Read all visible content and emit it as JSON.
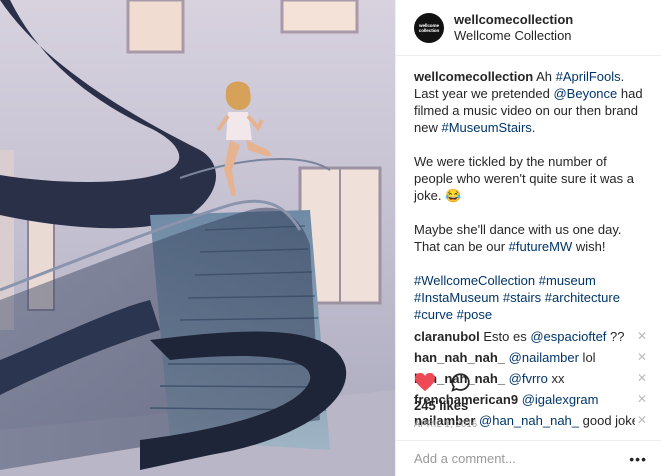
{
  "post": {
    "username": "wellcomecollection",
    "location": "Wellcome Collection",
    "avatar_text": "wellcome collection",
    "photo_alt": "Spiral staircase"
  },
  "caption": {
    "username": "wellcomecollection",
    "p1": [
      {
        "t": "Ah ",
        "k": "text"
      },
      {
        "t": "#AprilFools",
        "k": "tag"
      },
      {
        "t": ". Last year we pretended ",
        "k": "text"
      },
      {
        "t": "@Beyonce",
        "k": "tag"
      },
      {
        "t": " had filmed a music video on our then brand new ",
        "k": "text"
      },
      {
        "t": "#MuseumStairs",
        "k": "tag"
      },
      {
        "t": ".",
        "k": "text"
      }
    ],
    "p2": "We were tickled by the number of people who weren't quite sure it was a joke. 😂",
    "p3_text": "Maybe she'll dance with us one day. That can be our ",
    "p3_tag": "#futureMW",
    "p3_end": " wish!",
    "hashtags": "#WellcomeCollection #museum #InstaMuseum #stairs #architecture #curve #pose"
  },
  "comments": [
    {
      "user": "claranubol",
      "pre": "Esto es ",
      "mention": "@espacioftef",
      "post": " ??"
    },
    {
      "user": "han_nah_nah_",
      "pre": "",
      "mention": "@nailamber",
      "post": " lol"
    },
    {
      "user": "han_nah_nah_",
      "pre": "",
      "mention": "@fvrro",
      "post": " xx"
    },
    {
      "user": "frenchamerican9",
      "pre": "",
      "mention": "@igalexgram",
      "post": ""
    },
    {
      "user": "nailamber",
      "pre": "",
      "mention": "@han_nah_nah_",
      "post": " good joke u"
    }
  ],
  "likes": "245 likes",
  "date": "APRIL 1, 2016",
  "add_comment_placeholder": "Add a comment...",
  "more_label": "•••",
  "remove_label": "✕",
  "icons": {
    "like": "heart-icon",
    "comment": "speech-bubble-icon",
    "more": "more-options-icon",
    "remove": "close-icon"
  },
  "colors": {
    "heart": "#ed4956",
    "link": "#003569",
    "muted": "#999999"
  }
}
